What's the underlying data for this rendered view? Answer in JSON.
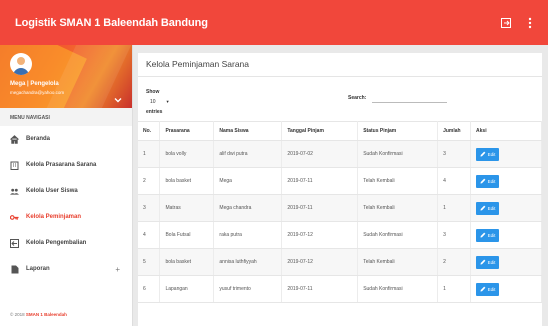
{
  "topbar": {
    "title": "Logistik SMAN 1 Baleendah Bandung"
  },
  "profile": {
    "name": "Mega | Pengelola",
    "email": "megachandra@yahoo.com"
  },
  "sidebar": {
    "header": "MENU NAVIGASI",
    "items": [
      {
        "label": "Beranda",
        "icon": "home-icon"
      },
      {
        "label": "Kelola Prasarana Sarana",
        "icon": "building-icon"
      },
      {
        "label": "Kelola User Siswa",
        "icon": "users-icon"
      },
      {
        "label": "Kelola Peminjaman",
        "icon": "key-icon"
      },
      {
        "label": "Kelola Pengembalian",
        "icon": "return-icon"
      },
      {
        "label": "Laporan",
        "icon": "file-icon",
        "expand": "+"
      }
    ]
  },
  "footer": {
    "prefix": "© 2018 ",
    "link": "SMAN 1 Baleendah"
  },
  "main": {
    "title": "Kelola Peminjaman Sarana",
    "show_label": "Show",
    "entries_value": "10",
    "entries_label": "entries",
    "search_label": "Search:",
    "columns": [
      "No.",
      "Prasarana",
      "Nama Siswa",
      "Tanggal Pinjam",
      "Status Pinjam",
      "Jumlah",
      "Aksi"
    ],
    "rows": [
      [
        "1",
        "bola volly",
        "alif dwi putra",
        "2019-07-02",
        "Sudah Konfirmasi",
        "3"
      ],
      [
        "2",
        "bola basket",
        "Mega",
        "2019-07-11",
        "Telah Kembali",
        "4"
      ],
      [
        "3",
        "Matras",
        "Mega chandra",
        "2019-07-11",
        "Telah Kembali",
        "1"
      ],
      [
        "4",
        "Bola Futsal",
        "raka putra",
        "2019-07-12",
        "Sudah Konfirmasi",
        "3"
      ],
      [
        "5",
        "bola basket",
        "annisa luthfiyyah",
        "2019-07-12",
        "Telah Kembali",
        "2"
      ],
      [
        "6",
        "Lapangan",
        "yusuf trimento",
        "2019-07-11",
        "Sudah Konfirmasi",
        "1"
      ]
    ],
    "edit_label": "Edit"
  },
  "colors": {
    "primary": "#f1473b",
    "active_menu": "#e8402f",
    "edit_button": "#2b95e9"
  }
}
